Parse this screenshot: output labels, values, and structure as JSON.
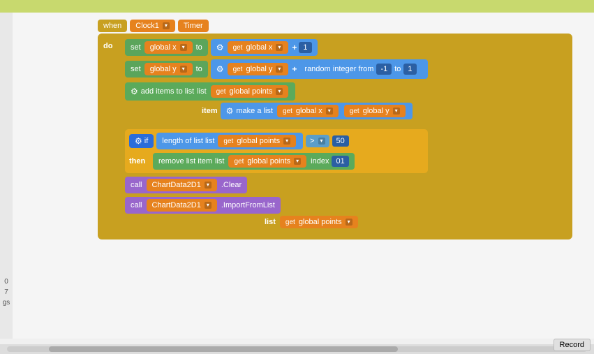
{
  "topbar": {
    "color": "#c8d96e"
  },
  "timer": {
    "when_label": "when",
    "clock1_label": "Clock1",
    "timer_label": "Timer"
  },
  "do_block": {
    "do_label": "do",
    "set_label": "set",
    "global_x_label": "global x",
    "to_label": "to",
    "get_label": "get",
    "global_x2_label": "global x",
    "plus_label": "+",
    "one_label": "1",
    "global_y_label": "global y",
    "global_y2_label": "global y",
    "minus1_label": "-1",
    "to2_label": "to",
    "one2_label": "1",
    "random_label": "random integer from",
    "add_items_label": "add items to list",
    "list_label": "list",
    "global_points_label": "global points",
    "item_label": "item",
    "make_a_list_label": "make a list",
    "get_global_x3_label": "global x",
    "get_global_y3_label": "global y",
    "if_label": "if",
    "length_of_list_label": "length of list",
    "list2_label": "list",
    "get_global_points2_label": "global points",
    "gt_label": ">",
    "fifty_label": "50",
    "then_label": "then",
    "remove_label": "remove list item",
    "list3_label": "list",
    "get_global_points3_label": "global points",
    "index_label": "index",
    "zero1_label": "01",
    "call_label": "call",
    "chart_data_label": "ChartData2D1",
    "clear_label": ".Clear",
    "call2_label": "call",
    "chart_data2_label": "ChartData2D1",
    "import_label": ".ImportFromList",
    "list4_label": "list",
    "get_global_points4_label": "global points"
  },
  "left_panel": {
    "numbers": "0 7",
    "label": "gs"
  },
  "scrollbar": {},
  "record_button": {
    "label": "Record"
  }
}
